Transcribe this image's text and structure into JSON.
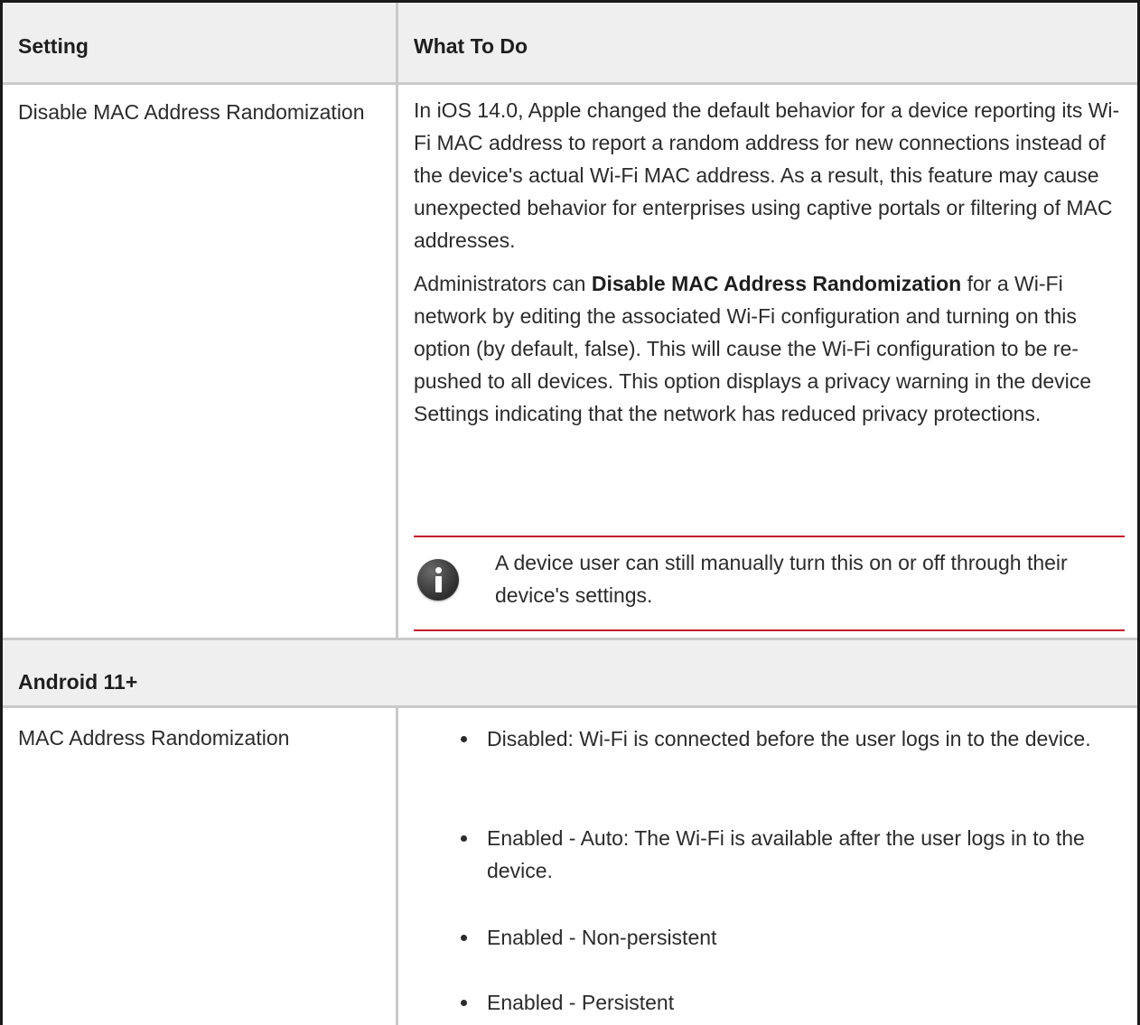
{
  "table": {
    "header": {
      "col1": "Setting",
      "col2": "What To Do"
    },
    "row1": {
      "setting": "Disable MAC Address Randomization",
      "para1": "In iOS 14.0, Apple changed the default behavior for a device reporting its Wi-Fi MAC address to report a random address for new connections instead of the device's actual Wi-Fi MAC address. As a result, this feature may cause unexpected behavior for enterprises using captive portals or filtering of MAC addresses.",
      "para2_before": "Administrators can ",
      "para2_bold": "Disable MAC Address Randomization",
      "para2_after": " for a Wi-Fi network by editing the associated Wi-Fi configuration and turning on this option (by default, false). This will cause the Wi-Fi configuration to be re-pushed to all devices. This option displays a privacy warning in the device Settings indicating that the network has reduced privacy protections.",
      "note_icon": "info-icon",
      "note": "A device user can still manually turn this on or off through their device's settings.",
      "note_border_color": "#c0172d"
    },
    "section": {
      "label": "Android 11+"
    },
    "row2": {
      "setting": "MAC Address Randomization",
      "bullets": [
        "Disabled: Wi-Fi is connected before the user logs in to the device.",
        "Enabled - Auto: The Wi-Fi is available after the user logs in to the device.",
        "Enabled - Non-persistent",
        "Enabled - Persistent"
      ]
    }
  }
}
